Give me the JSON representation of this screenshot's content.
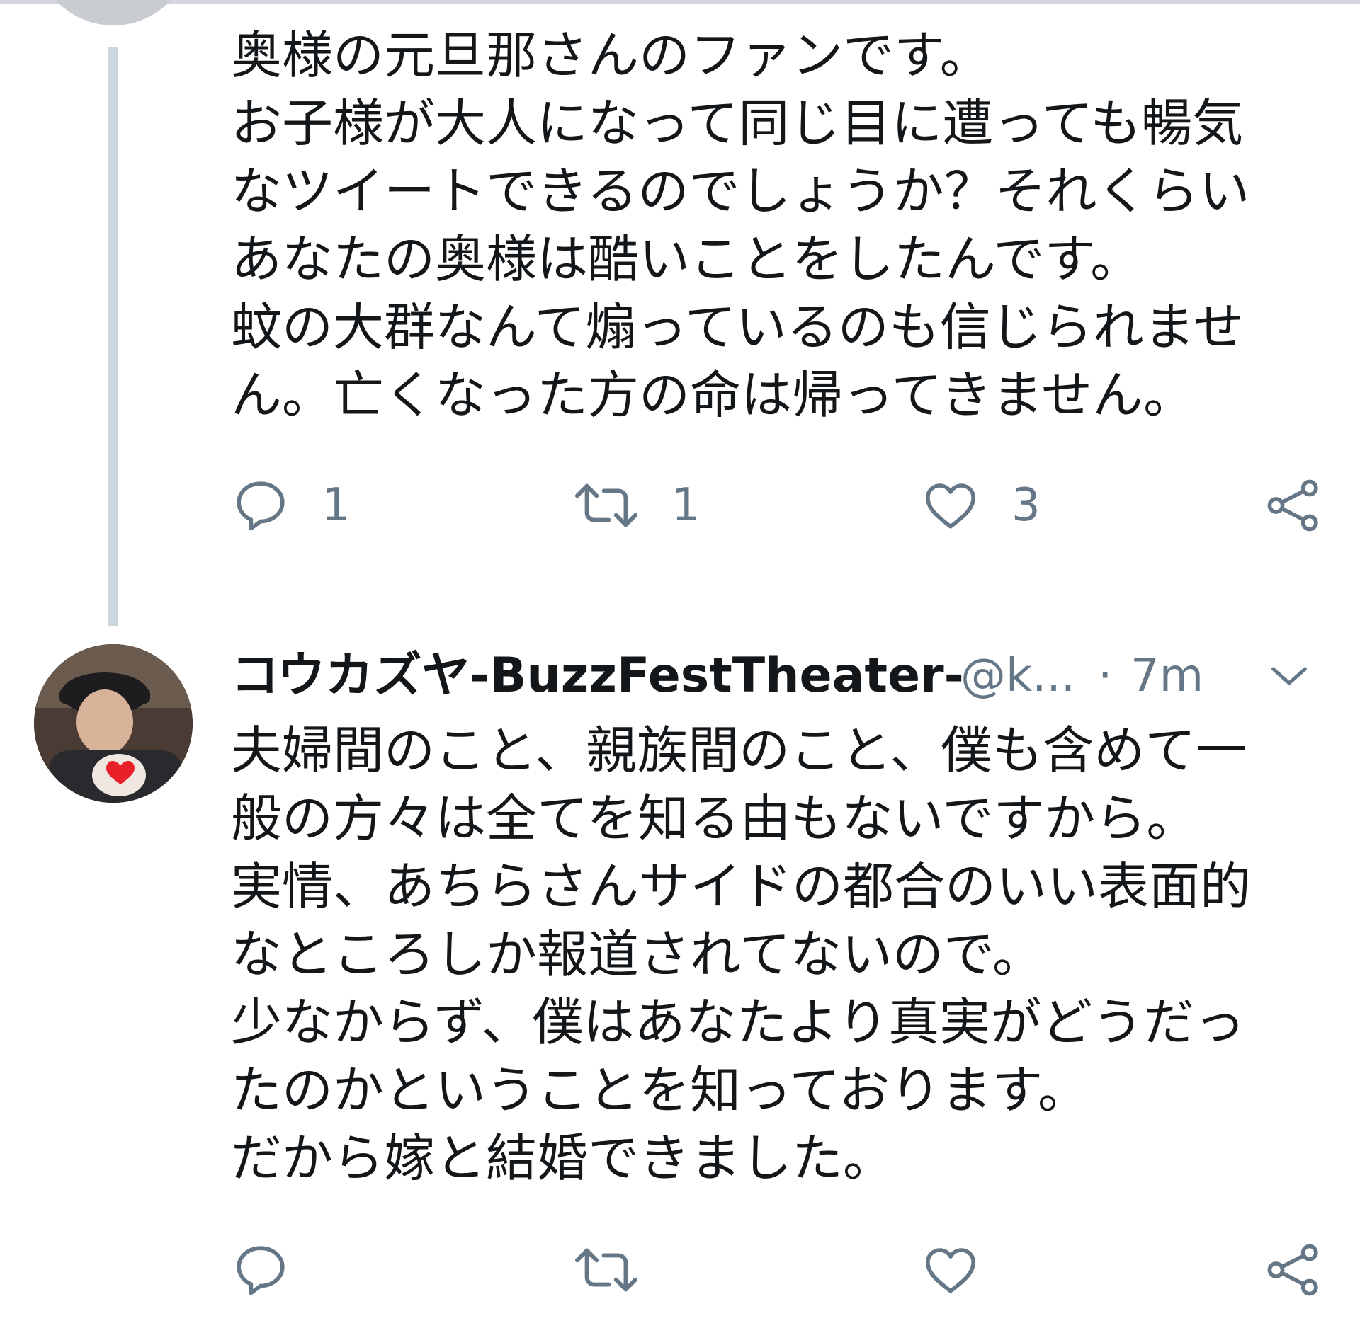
{
  "tweet1": {
    "lines": [
      "奥様の元旦那さんのファンです。",
      "お子様が大人になって同じ目に遭っても暢気",
      "なツイートできるのでしょうか？それくらい",
      "あなたの奥様は酷いことをしたんです。",
      "蚊の大群なんて煽っているのも信じられませ",
      "ん。亡くなった方の命は帰ってきません。"
    ],
    "actions": {
      "reply_count": "1",
      "retweet_count": "1",
      "like_count": "3"
    }
  },
  "tweet2": {
    "author": {
      "display_name": "コウカズヤ-BuzzFestTheater-",
      "handle": "@k...",
      "separator": "·",
      "time": "7m"
    },
    "lines": [
      "夫婦間のこと、親族間のこと、僕も含めて一",
      "般の方々は全てを知る由もないですから。",
      "実情、あちらさんサイドの都合のいい表面的",
      "なところしか報道されてないので。",
      "少なからず、僕はあなたより真実がどうだっ",
      "たのかということを知っております。",
      "だから嫁と結婚できました。"
    ]
  },
  "icons": {
    "reply": "reply-icon",
    "retweet": "retweet-icon",
    "like": "heart-icon",
    "share": "share-icon",
    "caret": "chevron-down-icon"
  },
  "colors": {
    "text": "#14171a",
    "secondary": "#657786",
    "icon": "#657786",
    "thread_line": "#ccd6dd",
    "avatar_heart": "#e8202a"
  }
}
